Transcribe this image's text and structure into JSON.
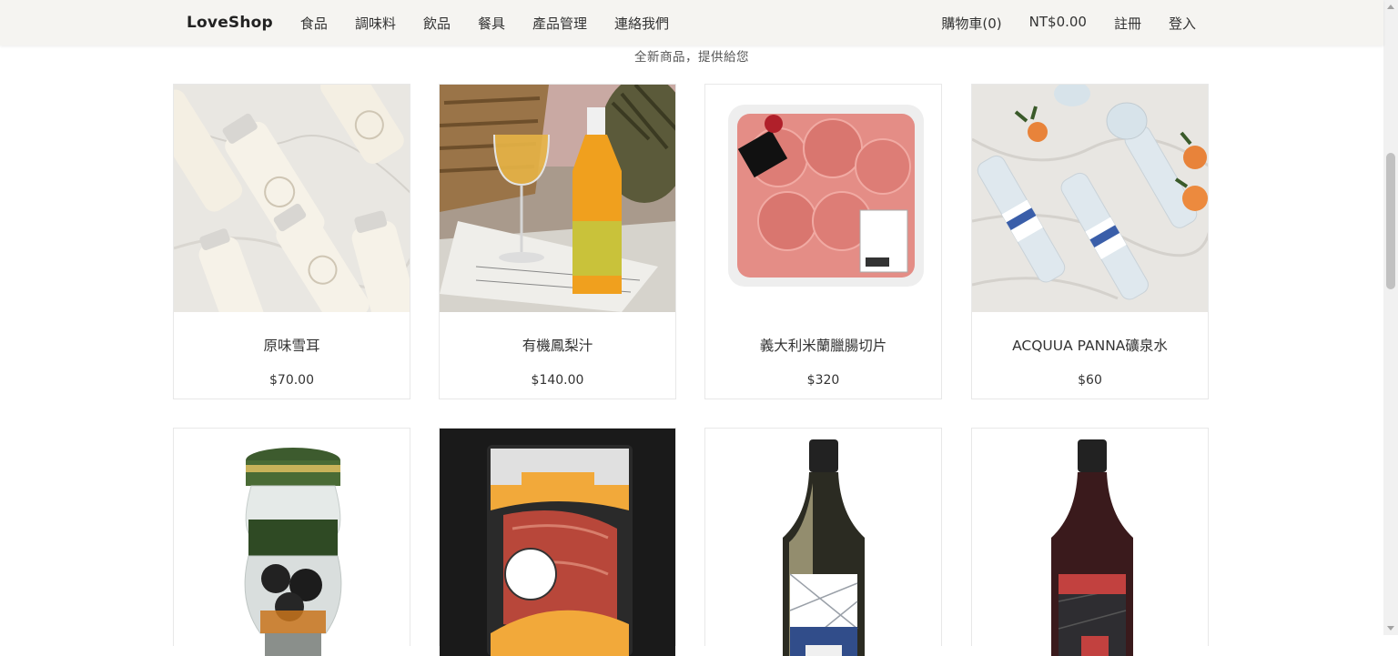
{
  "nav": {
    "brand": "LoveShop",
    "links": [
      "食品",
      "調味料",
      "飲品",
      "餐具",
      "產品管理",
      "連絡我們"
    ],
    "right": [
      "購物車(0)",
      "NT$0.00",
      "註冊",
      "登入"
    ]
  },
  "subtitle": "全新商品，提供給您",
  "products": [
    {
      "name": "原味雪耳",
      "price": "$70.00",
      "image": "snow-fungus-bottles"
    },
    {
      "name": "有機鳳梨汁",
      "price": "$140.00",
      "image": "pineapple-juice"
    },
    {
      "name": "義大利米蘭臘腸切片",
      "price": "$320",
      "image": "salami-pack"
    },
    {
      "name": "ACQUUA PANNA礦泉水",
      "price": "$60",
      "image": "mineral-water"
    },
    {
      "image": "truffle-jar"
    },
    {
      "image": "serrano-ham-pack"
    },
    {
      "image": "white-wine-bottle"
    },
    {
      "image": "red-wine-bottle"
    }
  ],
  "colors": {
    "navbar": "#f5f4f1",
    "text": "#333333",
    "border": "#e8e8e8"
  }
}
